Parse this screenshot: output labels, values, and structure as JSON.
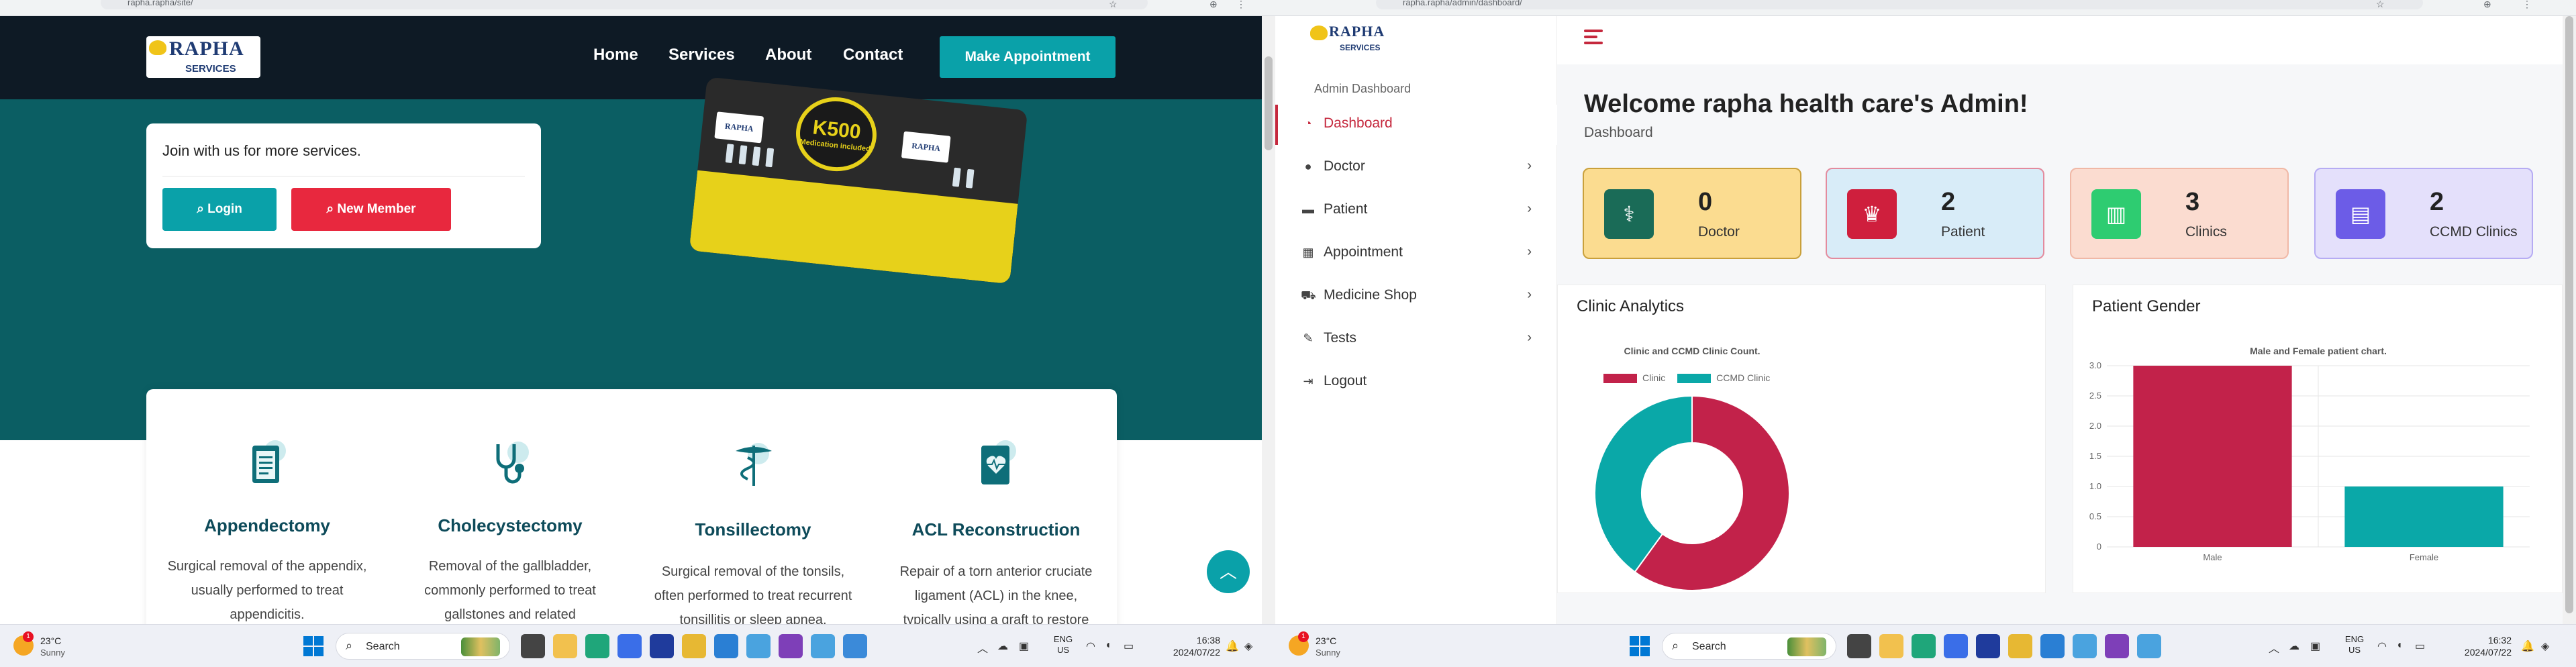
{
  "left": {
    "browser": {
      "url": "rapha.rapha/site/"
    },
    "nav": {
      "logo_top": "RAPHA",
      "logo_bottom": "SERVICES",
      "links": [
        "Home",
        "Services",
        "About",
        "Contact"
      ],
      "cta": "Make Appointment"
    },
    "hero": {
      "join_text": "Join with us for more services.",
      "login": "Login",
      "new_member": "New Member",
      "banner_price": "K500",
      "banner_sub": "Medication included",
      "sign": "RAPHA"
    },
    "services": [
      {
        "title": "Appendectomy",
        "desc": [
          "Surgical removal of the appendix,",
          "usually performed to treat",
          "appendicitis."
        ],
        "icon": "clipboard-icon"
      },
      {
        "title": "Cholecystectomy",
        "desc": [
          "Removal of the gallbladder,",
          "commonly performed to treat",
          "gallstones and related"
        ],
        "icon": "stethoscope-icon"
      },
      {
        "title": "Tonsillectomy",
        "desc": [
          "Surgical removal of the tonsils,",
          "often performed to treat recurrent",
          "tonsillitis or sleep apnea."
        ],
        "icon": "caduceus-icon"
      },
      {
        "title": "ACL Reconstruction",
        "desc": [
          "Repair of a torn anterior cruciate",
          "ligament (ACL) in the knee,",
          "typically using a graft to restore"
        ],
        "icon": "heart-monitor-icon"
      }
    ],
    "taskbar": {
      "temp": "23°C",
      "weather": "Sunny",
      "badge": "1",
      "search": "Search",
      "lang1": "ENG",
      "lang2": "US",
      "time": "16:38",
      "date": "2024/07/22"
    }
  },
  "right": {
    "browser": {
      "url": "rapha.rapha/admin/dashboard/"
    },
    "logo_top": "RAPHA",
    "logo_bottom": "SERVICES",
    "sidebar": {
      "title": "Admin Dashboard",
      "items": [
        {
          "label": "Dashboard",
          "icon": "dashboard-icon",
          "chevron": false
        },
        {
          "label": "Doctor",
          "icon": "user-icon",
          "chevron": true
        },
        {
          "label": "Patient",
          "icon": "bed-icon",
          "chevron": true
        },
        {
          "label": "Appointment",
          "icon": "calendar-icon",
          "chevron": true
        },
        {
          "label": "Medicine Shop",
          "icon": "truck-icon",
          "chevron": true
        },
        {
          "label": "Tests",
          "icon": "pen-icon",
          "chevron": true
        },
        {
          "label": "Logout",
          "icon": "logout-icon",
          "chevron": false
        }
      ]
    },
    "welcome": "Welcome rapha health care's Admin!",
    "breadcrumb": "Dashboard",
    "stats": [
      {
        "value": "0",
        "label": "Doctor",
        "bg": "#fbdc90",
        "border": "#c9a03b",
        "box": "#1a6b57"
      },
      {
        "value": "2",
        "label": "Patient",
        "bg": "#d8ecf8",
        "border": "#e38b9e",
        "box": "#cf1f3d"
      },
      {
        "value": "3",
        "label": "Clinics",
        "bg": "#fbdcd0",
        "border": "#f0b8a6",
        "box": "#2ecc71"
      },
      {
        "value": "2",
        "label": "CCMD Clinics",
        "bg": "#e4e0fb",
        "border": "#b6acf3",
        "box": "#6c5ce7"
      }
    ],
    "panels": {
      "analytics": "Clinic Analytics",
      "gender": "Patient Gender"
    },
    "chart_data": [
      {
        "type": "pie",
        "title": "Clinic and CCMD Clinic Count.",
        "categories": [
          "Clinic",
          "CCMD Clinic"
        ],
        "values": [
          3,
          2
        ],
        "colors": [
          "#c2224a",
          "#0aa8a8"
        ]
      },
      {
        "type": "bar",
        "title": "Male and Female patient chart.",
        "categories": [
          "Male",
          "Female"
        ],
        "values": [
          3,
          1
        ],
        "colors": [
          "#c2224a",
          "#0aa8a8"
        ],
        "ylim": [
          0,
          3
        ],
        "yticks": [
          "0",
          "0.5",
          "1.0",
          "1.5",
          "2.0",
          "2.5",
          "3.0"
        ]
      }
    ],
    "taskbar": {
      "temp": "23°C",
      "weather": "Sunny",
      "badge": "1",
      "search": "Search",
      "lang1": "ENG",
      "lang2": "US",
      "time": "16:32",
      "date": "2024/07/22"
    }
  }
}
